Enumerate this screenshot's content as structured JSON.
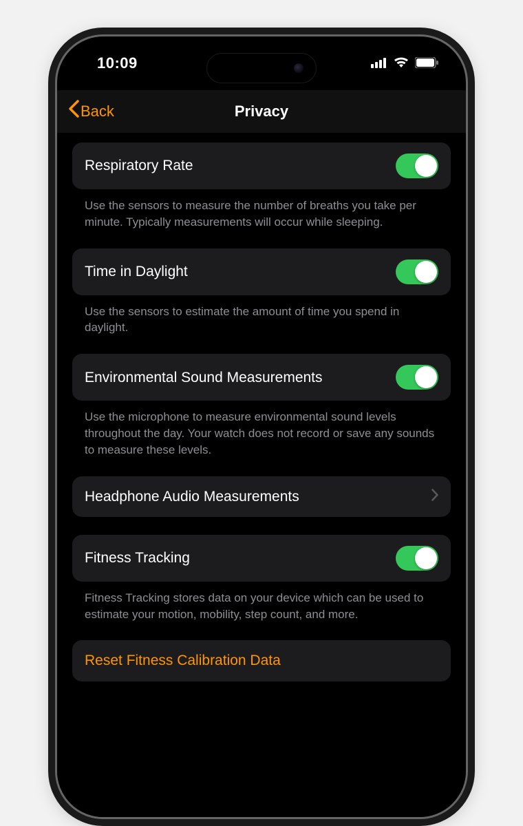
{
  "status": {
    "time": "10:09"
  },
  "nav": {
    "back_label": "Back",
    "title": "Privacy"
  },
  "sections": {
    "respiratory": {
      "label": "Respiratory Rate",
      "footer": "Use the sensors to measure the number of breaths you take per minute. Typically measurements will occur while sleeping.",
      "on": true
    },
    "daylight": {
      "label": "Time in Daylight",
      "footer": "Use the sensors to estimate the amount of time you spend in daylight.",
      "on": true
    },
    "env_sound": {
      "label": "Environmental Sound Measurements",
      "footer": "Use the microphone to measure environmental sound levels throughout the day. Your watch does not record or save any sounds to measure these levels.",
      "on": true
    },
    "headphone": {
      "label": "Headphone Audio Measurements"
    },
    "fitness": {
      "label": "Fitness Tracking",
      "footer": "Fitness Tracking stores data on your device which can be used to estimate your motion, mobility, step count, and more.",
      "on": true
    },
    "reset": {
      "label": "Reset Fitness Calibration Data"
    }
  },
  "colors": {
    "accent": "#ff9500",
    "toggle_on": "#34c759",
    "row_bg": "#1c1c1e",
    "secondary_text": "#8e8e93"
  }
}
